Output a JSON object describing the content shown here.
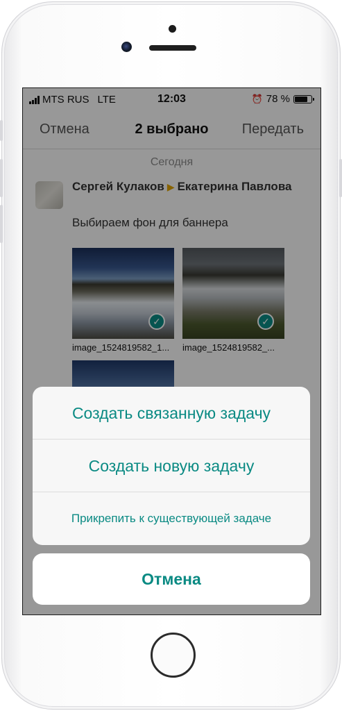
{
  "status_bar": {
    "carrier": "MTS RUS",
    "network": "LTE",
    "time": "12:03",
    "alarm_icon": "alarm-clock-icon",
    "battery_percent": "78 %",
    "battery_level": 0.78
  },
  "nav": {
    "cancel_label": "Отмена",
    "title": "2 выбрано",
    "send_label": "Передать"
  },
  "feed": {
    "date_label": "Сегодня",
    "message": {
      "sender": "Сергей Кулаков",
      "arrow_icon": "triangle-right-icon",
      "recipient": "Екатерина Павлова",
      "text": "Выбираем фон для баннера",
      "attachments": [
        {
          "filename": "image_1524819582_1...",
          "selected": true
        },
        {
          "filename": "image_1524819582_...",
          "selected": true
        },
        {
          "filename": "",
          "selected": false
        }
      ]
    }
  },
  "action_sheet": {
    "items": [
      {
        "label": "Создать связанную задачу"
      },
      {
        "label": "Создать новую задачу"
      },
      {
        "label": "Прикрепить к существующей задаче"
      }
    ],
    "cancel_label": "Отмена"
  },
  "colors": {
    "accent": "#0a8a83",
    "overlay": "rgba(0,0,0,0.4)",
    "arrow": "#e2a400"
  }
}
